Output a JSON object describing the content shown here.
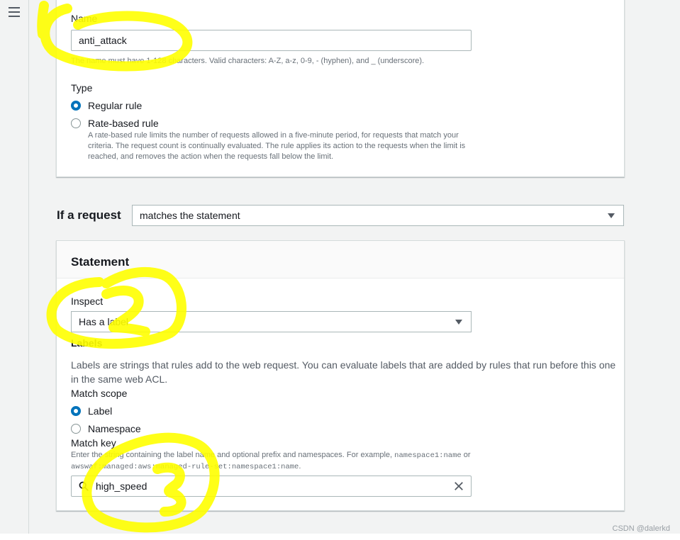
{
  "rule": {
    "name_label": "Name",
    "name_value": "anti_attack",
    "name_hint": "The name must have 1-128 characters. Valid characters: A-Z, a-z, 0-9, - (hyphen), and _ (underscore).",
    "type_label": "Type",
    "type_options": [
      {
        "label": "Regular rule",
        "selected": true
      },
      {
        "label": "Rate-based rule",
        "selected": false
      }
    ],
    "rate_based_description": "A rate-based rule limits the number of requests allowed in a five-minute period, for requests that match your criteria. The request count is continually evaluated. The rule applies its action to the requests when the limit is reached, and removes the action when the requests fall below the limit."
  },
  "condition": {
    "label": "If a request",
    "selected": "matches the statement"
  },
  "statement": {
    "title": "Statement",
    "inspect_label": "Inspect",
    "inspect_value": "Has a label",
    "labels_heading": "Labels",
    "labels_description": "Labels are strings that rules add to the web request. You can evaluate labels that are added by rules that run before this one in the same web ACL.",
    "match_scope_label": "Match scope",
    "match_scope_options": [
      {
        "label": "Label",
        "selected": true
      },
      {
        "label": "Namespace",
        "selected": false
      }
    ],
    "match_key_label": "Match key",
    "match_key_hint_prefix": "Enter the string containing the label name and optional prefix and namespaces. For example,",
    "match_key_example_1": "namespace1:name",
    "match_key_hint_or": "or",
    "match_key_example_2": "awswaf:managed:aws:managed-rule-set:namespace1:name",
    "match_key_hint_suffix": ".",
    "match_key_value": "high_speed"
  },
  "watermark": "CSDN @dalerkd",
  "annotation_color": "#ffff00",
  "accent_color": "#0073bb"
}
